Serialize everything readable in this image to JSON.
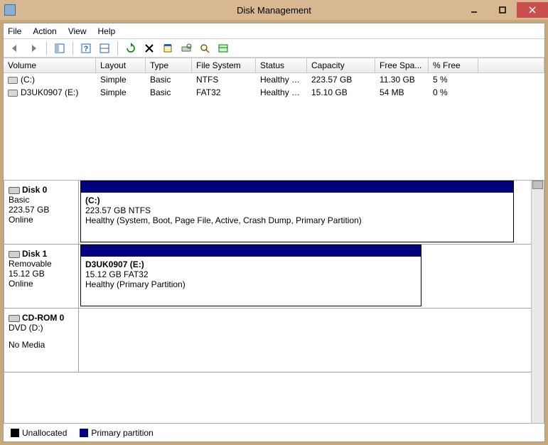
{
  "window": {
    "title": "Disk Management"
  },
  "menubar": {
    "file": "File",
    "action": "Action",
    "view": "View",
    "help": "Help"
  },
  "columns": {
    "volume": "Volume",
    "layout": "Layout",
    "type": "Type",
    "filesystem": "File System",
    "status": "Status",
    "capacity": "Capacity",
    "freespace": "Free Spa...",
    "percentfree": "% Free"
  },
  "colwidths": {
    "volume": 130,
    "layout": 70,
    "type": 65,
    "filesystem": 90,
    "status": 72,
    "capacity": 96,
    "freespace": 75,
    "percentfree": 70
  },
  "volumes": [
    {
      "name": "(C:)",
      "layout": "Simple",
      "type": "Basic",
      "filesystem": "NTFS",
      "status": "Healthy (S...",
      "capacity": "223.57 GB",
      "freespace": "11.30 GB",
      "percentfree": "5 %"
    },
    {
      "name": "D3UK0907 (E:)",
      "layout": "Simple",
      "type": "Basic",
      "filesystem": "FAT32",
      "status": "Healthy (P...",
      "capacity": "15.10 GB",
      "freespace": "54 MB",
      "percentfree": "0 %"
    }
  ],
  "disks": [
    {
      "title": "Disk 0",
      "kind": "Basic",
      "size": "223.57 GB",
      "state": "Online",
      "partition": {
        "name": "(C:)",
        "size_fs": "223.57 GB NTFS",
        "status": "Healthy (System, Boot, Page File, Active, Crash Dump, Primary Partition)"
      },
      "partWidth": 610
    },
    {
      "title": "Disk 1",
      "kind": "Removable",
      "size": "15.12 GB",
      "state": "Online",
      "partition": {
        "name": "D3UK0907  (E:)",
        "size_fs": "15.12 GB FAT32",
        "status": "Healthy (Primary Partition)"
      },
      "partWidth": 480
    },
    {
      "title": "CD-ROM 0",
      "kind": "DVD (D:)",
      "size": "",
      "state": "No Media",
      "partition": null,
      "partWidth": 0
    }
  ],
  "legend": {
    "unallocated": "Unallocated",
    "primary": "Primary partition"
  },
  "colors": {
    "unallocated": "#000000",
    "primary": "#000080"
  }
}
